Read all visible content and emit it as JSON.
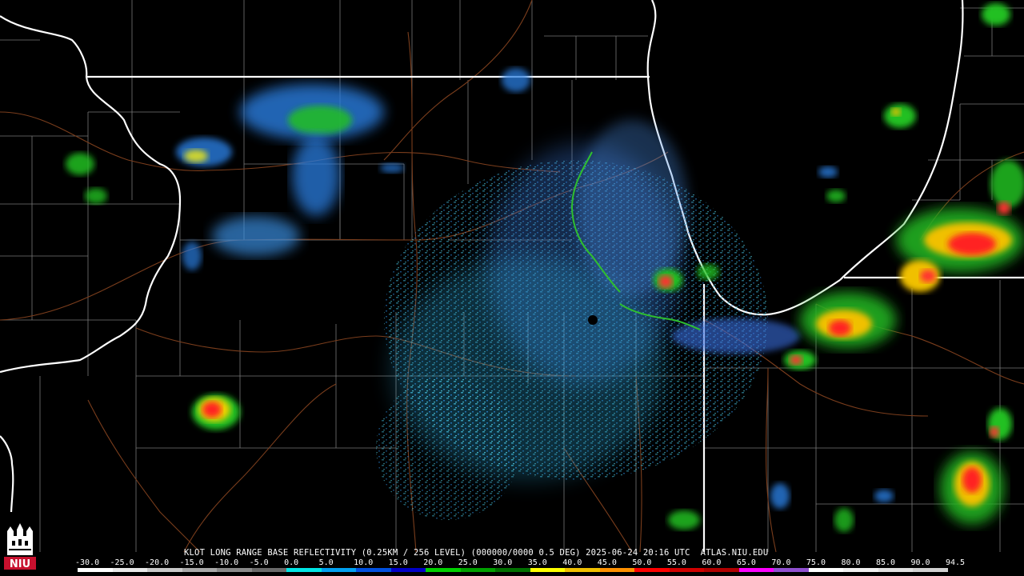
{
  "map": {
    "type": "radar-reflectivity",
    "region": "Northern Illinois / Lake Michigan",
    "radar_site_marker": "radar-site-dot",
    "boundary_color": "#ffffff",
    "county_color": "#8c8c8c",
    "road_color": "#7a3d1c",
    "river_color": "#2fbf2f"
  },
  "caption": "KLOT LONG RANGE BASE REFLECTIVITY (0.25KM / 256 LEVEL) (000000/0000 0.5 DEG) 2025-06-24 20:16 UTC  ATLAS.NIU.EDU",
  "scale": {
    "labels": [
      "-30.0",
      "-25.0",
      "-20.0",
      "-15.0",
      "-10.0",
      "-5.0",
      "0.0",
      "5.0",
      "10.0",
      "15.0",
      "20.0",
      "25.0",
      "30.0",
      "35.0",
      "40.0",
      "45.0",
      "50.0",
      "55.0",
      "60.0",
      "65.0",
      "70.0",
      "75.0",
      "80.0",
      "85.0",
      "90.0",
      "94.5"
    ],
    "colors": [
      "#ffffff",
      "#e8e8e8",
      "#c8c8c8",
      "#a8a8a8",
      "#8a8a8a",
      "#6a6a6a",
      "#00e5e5",
      "#00a0f0",
      "#0050e0",
      "#0000c8",
      "#00d000",
      "#00a000",
      "#007000",
      "#ffff00",
      "#f0c000",
      "#ff9000",
      "#ff0000",
      "#d00000",
      "#b00000",
      "#ff00ff",
      "#9050d0",
      "#ffffff",
      "#f0f0f0",
      "#e0e0e0",
      "#d0d0d0"
    ]
  },
  "logo": {
    "text": "NIU"
  }
}
